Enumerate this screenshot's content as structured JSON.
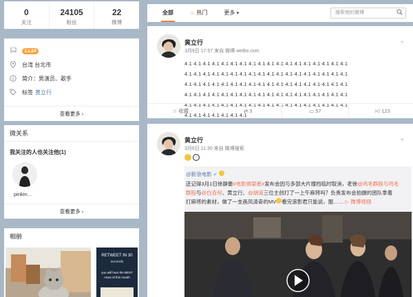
{
  "stats": [
    {
      "num": "0",
      "label": "关注"
    },
    {
      "num": "24105",
      "label": "粉丝"
    },
    {
      "num": "22",
      "label": "微博"
    }
  ],
  "info": {
    "level": "Lv.14",
    "location": "台湾 台北市",
    "intro": "简介：男演员、歌手",
    "tags_label": "标签",
    "tag": "黄立行",
    "see_more": "查看更多 ›"
  },
  "micro": {
    "title": "微关系",
    "subtitle": "我关注的人也关注他(1)",
    "person": "pinkin...",
    "see_more": "查看更多 ›"
  },
  "album": {
    "title": "相册",
    "retweet_lines": [
      "RETWEET IN 30",
      "seconds",
      "you will hear the BEST",
      "news of this month"
    ]
  },
  "tabs": [
    {
      "label": "全部",
      "active": true
    },
    {
      "label": "热门",
      "active": false
    },
    {
      "label": "更多",
      "active": false
    }
  ],
  "search": {
    "placeholder": "搜索他的微博"
  },
  "post1": {
    "author": "黄立行",
    "meta": "3月9日 17:57 来自 微博 weibo.com",
    "lines": [
      "4.1 4.1 4.1 4.1 4.1 4.1 4.1 4.1 4.1 4.1 4.1 4.1 4.1 4.1 4.1 4.1 4.1 4.1",
      "4.1 4.1 4.1 4.1 4.1 4.1 4.1 4.1 4.1 4.1 4.1 4.1 4.1 4.1 4.1 4.1 4.1 4.1",
      "4.1 4.1 4.1 4.1 4.1 4.1 4.1 4.1 4.1 4.1 4.1 4.1 4.1 4.1 4.1 4.1 4.1 4.1",
      "4.1 4.1 4.1 4.1 4.1 4.1 4.1 4.1 4.1 4.1 4.1 4.1 4.1 4.1 4.1 4.1 4.1 4.1",
      "4.1 4.1 4.1 4.1 4.1 4.1 4.1 4.1 4.1 4.1 4.1 4.1 4.1 4.1 4.1 4.1 4.1 4.1",
      "4.1 4.1 4.1 4.1 4.1 4.1 4.1"
    ],
    "actions": {
      "fav": "收藏",
      "repost": "3",
      "comment": "57",
      "like": "123"
    }
  },
  "post2": {
    "author": "黄立行",
    "meta": "3月6日 11:30 来自 微博搜索",
    "repost_from": "@新浪电影",
    "text_a": "还记得3月1日徐静蕾",
    "topic": "#电影绑架者#",
    "text_b": "发布会因与多部大片撞档临时取消，老徐",
    "mention1": "@鸡毛群殴与鸡毛",
    "line2_a": "群殴",
    "text_c": "与",
    "mention2": "@白百何",
    "text_d": "、黄立行、",
    "mention3": "@胡道",
    "text_e": "三位主创打了一上午麻将吗？负责发布会拍摄的团队拿着",
    "text_f": "打麻将的素材，做了一支画风清奇的MV",
    "text_g": "看完滚影君只能说，服……",
    "video_link": "微博视频"
  },
  "colors": {
    "background": "#a9b8c7",
    "accent": "#fa7d3c",
    "link": "#eb7350",
    "level_badge": "#f7a541"
  }
}
